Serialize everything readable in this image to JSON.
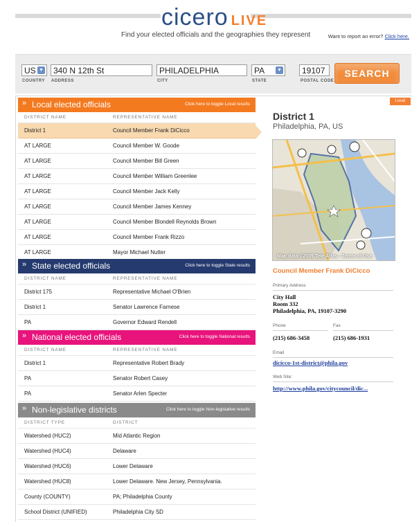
{
  "header": {
    "logo_main": "cicero",
    "logo_sub": "LIVE",
    "tagline": "Find your elected officials and the geographies they represent",
    "report_text": "Want to report an error? ",
    "report_link": "Click here."
  },
  "search": {
    "country": "US",
    "address": "340 N 12th St",
    "city": "PHILADELPHIA",
    "state": "PA",
    "postal": "19107",
    "country_label": "COUNTRY",
    "address_label": "ADDRESS",
    "city_label": "CITY",
    "state_label": "STATE",
    "postal_label": "POSTAL CODE",
    "button": "SEARCH"
  },
  "local": {
    "title": "Local elected officials",
    "toggle": "Click here to toggle Local results",
    "col1": "DISTRICT NAME",
    "col2": "REPRESENTATIVE NAME",
    "rows": [
      {
        "d": "District 1",
        "r": "Council Member Frank DiCicco"
      },
      {
        "d": "AT LARGE",
        "r": "Council Member W. Goode"
      },
      {
        "d": "AT LARGE",
        "r": "Council Member Bill Green"
      },
      {
        "d": "AT LARGE",
        "r": "Council Member William Greenlee"
      },
      {
        "d": "AT LARGE",
        "r": "Council Member Jack Kelly"
      },
      {
        "d": "AT LARGE",
        "r": "Council Member James Kenney"
      },
      {
        "d": "AT LARGE",
        "r": "Council Member Blondell Reynolds Brown"
      },
      {
        "d": "AT LARGE",
        "r": "Council Member Frank Rizzo"
      },
      {
        "d": "AT LARGE",
        "r": "Mayor Michael Nutter"
      }
    ]
  },
  "state": {
    "title": "State elected officials",
    "toggle": "Click here to toggle State results",
    "col1": "DISTRICT NAME",
    "col2": "REPRESENTATIVE NAME",
    "rows": [
      {
        "d": "District 175",
        "r": "Representative Michael O'Brien"
      },
      {
        "d": "District 1",
        "r": "Senator Lawrence Farnese"
      },
      {
        "d": "PA",
        "r": "Governor Edward Rendell"
      }
    ]
  },
  "national": {
    "title": "National elected officials",
    "toggle": "Click here to toggle National results",
    "col1": "DISTRICT NAME",
    "col2": "REPRESENTATIVE NAME",
    "rows": [
      {
        "d": "District 1",
        "r": "Representative Robert Brady"
      },
      {
        "d": "PA",
        "r": "Senator Robert Casey"
      },
      {
        "d": "PA",
        "r": "Senator Arlen Specter"
      }
    ]
  },
  "nonleg": {
    "title": "Non-legislative districts",
    "toggle": "Click here to toggle Non-legislative results",
    "col1": "DISTRICT TYPE",
    "col2": "DISTRICT",
    "rows": [
      {
        "d": "Watershed (HUC2)",
        "r": "Mid Atlantic Region"
      },
      {
        "d": "Watershed (HUC4)",
        "r": "Delaware"
      },
      {
        "d": "Watershed (HUC6)",
        "r": "Lower Delaware"
      },
      {
        "d": "Watershed (HUC8)",
        "r": "Lower Delaware. New Jersey, Pennsylvania."
      },
      {
        "d": "County (COUNTY)",
        "r": "PA; Philadelphia County"
      },
      {
        "d": "School District (UNIFIED)",
        "r": "Philadelphia City SD"
      }
    ]
  },
  "detail": {
    "badge": "Local",
    "district": "District 1",
    "location": "Philadelphia, PA, US",
    "map_note": "Map data ©2009 Tele Atlas - Terms of Use",
    "official": "Council Member Frank DiCicco",
    "address_label": "Primary Address",
    "address_lines": [
      "City Hall",
      "Room 332",
      "Philadelphia, PA, 19107-3290"
    ],
    "phone_label": "Phone",
    "phone": "(215) 686-3458",
    "fax_label": "Fax",
    "fax": "(215) 686-1931",
    "email_label": "Email",
    "email": "dicicco-1st-district@phila.gov",
    "web_label": "Web Site:",
    "web": "http://www.phila.gov/citycouncil/dic..."
  },
  "colors": {
    "local": "#f47a20",
    "state": "#253a6e",
    "national": "#e8147c",
    "nonleg": "#8a8a8a",
    "accent": "#f07d2d"
  }
}
